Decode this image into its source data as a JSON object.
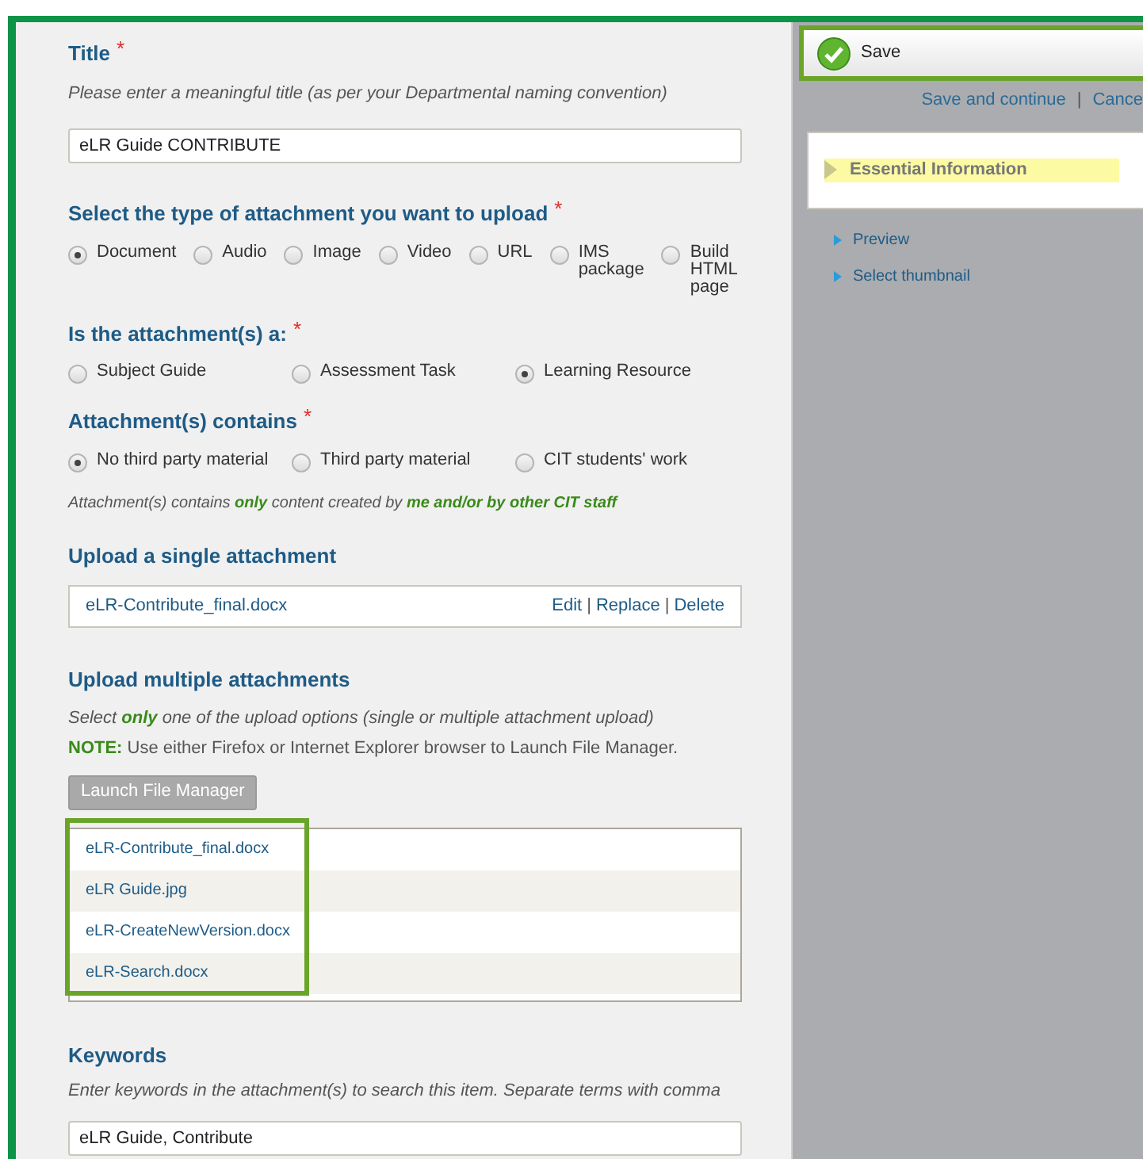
{
  "title_field": {
    "label": "Title",
    "required_mark": "*",
    "hint": "Please enter a meaningful title (as per your Departmental naming convention)",
    "value": "eLR Guide CONTRIBUTE"
  },
  "attachment_type": {
    "label": "Select the type of attachment you want to upload",
    "required_mark": "*",
    "options": [
      {
        "label": "Document",
        "selected": true
      },
      {
        "label": "Audio",
        "selected": false
      },
      {
        "label": "Image",
        "selected": false
      },
      {
        "label": "Video",
        "selected": false
      },
      {
        "label": "URL",
        "selected": false
      },
      {
        "label": "IMS package",
        "selected": false
      },
      {
        "label": "Build HTML page",
        "selected": false
      }
    ]
  },
  "attachment_is": {
    "label": "Is the attachment(s) a:",
    "required_mark": "*",
    "options": [
      {
        "label": "Subject Guide",
        "selected": false
      },
      {
        "label": "Assessment Task",
        "selected": false
      },
      {
        "label": "Learning Resource",
        "selected": true
      }
    ]
  },
  "attachment_contains": {
    "label": "Attachment(s) contains",
    "required_mark": "*",
    "options": [
      {
        "label": "No third party material",
        "selected": true
      },
      {
        "label": "Third party material",
        "selected": false
      },
      {
        "label": "CIT students' work",
        "selected": false
      }
    ],
    "note": "Attachment(s) contains **only** content created by **me and/or by other CIT staff**"
  },
  "single_upload": {
    "label": "Upload a single attachment",
    "file": "eLR-Contribute_final.docx",
    "actions": [
      "Edit",
      "Replace",
      "Delete"
    ],
    "separator": "|"
  },
  "multiple_upload": {
    "label": "Upload multiple attachments",
    "hint": "Select **only** one of the upload options (single or multiple attachment upload)",
    "note": "**NOTE:** Use either Firefox or Internet Explorer browser to Launch File Manager.",
    "button": "Launch File Manager",
    "files": [
      "eLR-Contribute_final.docx",
      "eLR Guide.jpg",
      "eLR-CreateNewVersion.docx",
      "eLR-Search.docx"
    ]
  },
  "keywords": {
    "label": "Keywords",
    "hint": "Enter keywords in the attachment(s) to search this item. Separate terms with comma",
    "value": "eLR Guide, Contribute"
  },
  "sidebar": {
    "save_button": "Save",
    "links": [
      "Save and continue",
      "Cance"
    ],
    "link_separator": "|",
    "sections": [
      {
        "label": "Essential Information",
        "selected": true
      }
    ],
    "items": [
      "Preview",
      "Select thumbnail"
    ]
  }
}
